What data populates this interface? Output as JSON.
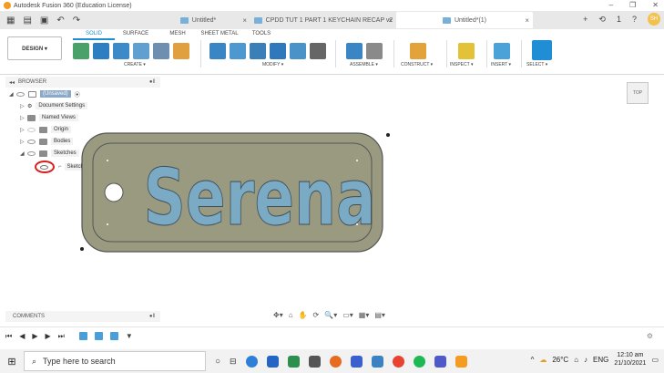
{
  "window": {
    "title": "Autodesk Fusion 360 (Education License)",
    "minimize": "–",
    "restore": "❐",
    "close": "✕"
  },
  "tabs": [
    {
      "label": "Untitled*"
    },
    {
      "label": "CPDD TUT 1 PART 1 KEYCHAIN RECAP v2"
    },
    {
      "label": "Untitled*(1)"
    }
  ],
  "tab_close": "×",
  "quick_access": [
    "▦",
    "▤",
    "▣",
    "↶",
    "↷"
  ],
  "tab_right": {
    "add": "+",
    "refresh": "⟲",
    "jobs": "1",
    "help": "?",
    "user": "SH"
  },
  "workspace": {
    "tabs": [
      "SOLID",
      "SURFACE",
      "MESH",
      "SHEET METAL",
      "TOOLS"
    ],
    "active": "SOLID"
  },
  "toolbar": {
    "design_label": "DESIGN ▾",
    "groups": [
      "CREATE ▾",
      "MODIFY ▾",
      "ASSEMBLE ▾",
      "CONSTRUCT ▾",
      "INSPECT ▾",
      "INSERT ▾",
      "SELECT ▾"
    ]
  },
  "browser": {
    "title": "BROWSER",
    "items": [
      {
        "label": "(Unsaved)"
      },
      {
        "label": "Document Settings"
      },
      {
        "label": "Named Views"
      },
      {
        "label": "Origin"
      },
      {
        "label": "Bodies"
      },
      {
        "label": "Sketches"
      },
      {
        "label": "Sketch1"
      }
    ]
  },
  "viewcube": {
    "label": "TOP"
  },
  "canvas": {
    "text": "Serena",
    "text_color": "#7aaac4",
    "plate_color": "#9a9a80"
  },
  "comments": {
    "title": "COMMENTS"
  },
  "nav_tools": [
    "✥▾",
    "⌂",
    "✋",
    "⟳",
    "🔍▾",
    "▭▾",
    "▦▾",
    "▤▾"
  ],
  "timeline": [
    "⏮",
    "◀",
    "▶",
    "▶",
    "⏭"
  ],
  "taskbar": {
    "search_placeholder": "Type here to search",
    "weather": "26°C",
    "language": "ENG",
    "time": "12:10 am",
    "date": "21/10/2021"
  },
  "colors": {
    "accent": "#1f8ed4",
    "plate": "#9a9a80",
    "text": "#7aaac4"
  }
}
